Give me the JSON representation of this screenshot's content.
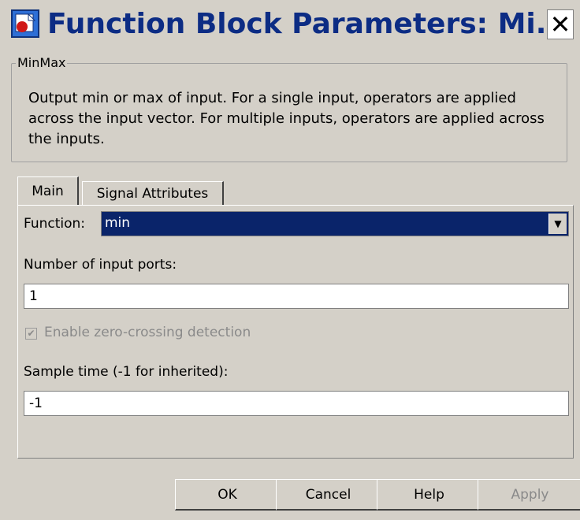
{
  "window": {
    "title": "Function Block Parameters: Mi...",
    "close_glyph": "✕"
  },
  "block": {
    "name": "MinMax",
    "description": "Output min or max of input.  For a single input, operators are applied across the input vector.  For multiple inputs, operators are applied across the inputs."
  },
  "tabs": [
    {
      "label": "Main",
      "active": true
    },
    {
      "label": "Signal Attributes",
      "active": false
    }
  ],
  "main": {
    "function_label": "Function:",
    "function_value": "min",
    "input_ports_label": "Number of input ports:",
    "input_ports_value": "1",
    "zero_crossing_label": "Enable zero-crossing detection",
    "zero_crossing_checked": true,
    "zero_crossing_enabled": false,
    "sample_time_label": "Sample time (-1 for inherited):",
    "sample_time_value": "-1"
  },
  "buttons": {
    "ok": "OK",
    "cancel": "Cancel",
    "help": "Help",
    "apply": "Apply"
  },
  "icons": {
    "app": "simulink-block-icon",
    "close": "close-icon",
    "dropdown": "chevron-down-icon",
    "check": "checkmark-icon"
  },
  "colors": {
    "background": "#d4d0c8",
    "title_text": "#0c2c84",
    "selection": "#0a246a",
    "disabled_text": "#8a8a8a"
  }
}
